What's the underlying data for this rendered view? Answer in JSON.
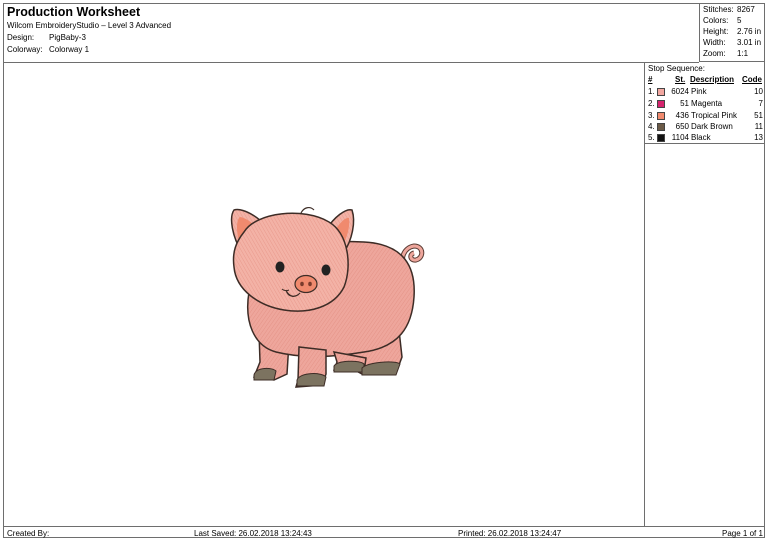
{
  "header": {
    "title": "Production Worksheet",
    "software": "Wilcom EmbroideryStudio – Level 3 Advanced",
    "design_label": "Design:",
    "design_value": "PigBaby-3",
    "colorway_label": "Colorway:",
    "colorway_value": "Colorway 1"
  },
  "stats": [
    {
      "label": "Stitches:",
      "value": "8267"
    },
    {
      "label": "Colors:",
      "value": "5"
    },
    {
      "label": "Height:",
      "value": "2.76 in"
    },
    {
      "label": "Width:",
      "value": "3.01 in"
    },
    {
      "label": "Zoom:",
      "value": "1:1"
    }
  ],
  "stop_sequence": {
    "title": "Stop Sequence:",
    "headers": {
      "num": "#",
      "st": "St.",
      "desc": "Description",
      "code": "Code"
    },
    "rows": [
      {
        "num": "1.",
        "st": "6024",
        "desc": "Pink",
        "code": "10",
        "color": "#f2a7a0"
      },
      {
        "num": "2.",
        "st": "51",
        "desc": "Magenta",
        "code": "7",
        "color": "#d6246e"
      },
      {
        "num": "3.",
        "st": "436",
        "desc": "Tropical Pink",
        "code": "51",
        "color": "#f08a6e"
      },
      {
        "num": "4.",
        "st": "650",
        "desc": "Dark Brown",
        "code": "11",
        "color": "#6b5a47"
      },
      {
        "num": "5.",
        "st": "1104",
        "desc": "Black",
        "code": "13",
        "color": "#111111"
      }
    ]
  },
  "footer": {
    "created_by": "Created By:",
    "last_saved": "Last Saved: 26.02.2018 13:24:43",
    "printed": "Printed: 26.02.2018 13:24:47",
    "page": "Page 1 of 1"
  },
  "design_image": {
    "name": "embroidered-pig-design"
  }
}
